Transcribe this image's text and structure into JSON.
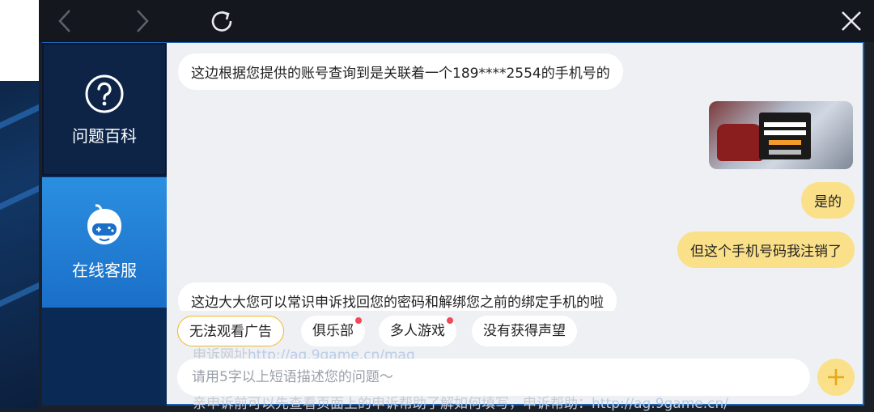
{
  "sidebar": {
    "tabs": [
      {
        "label": "问题百科",
        "icon": "question-icon"
      },
      {
        "label": "在线客服",
        "icon": "gamepad-mascot-icon"
      }
    ]
  },
  "chat": {
    "messages": [
      {
        "side": "left",
        "text": "这边根据您提供的账号查询到是关联着一个189****2554的手机号的"
      },
      {
        "side": "right",
        "type": "image",
        "icon": "screenshot-thumbnail"
      },
      {
        "side": "right",
        "text": "是的"
      },
      {
        "side": "right",
        "text": "但这个手机号码我注销了"
      },
      {
        "side": "left",
        "text": "这边大大您可以常识申诉找回您的密码和解绑您之前的绑定手机的啦"
      }
    ],
    "faded": {
      "prefix": "申诉网址",
      "url": "http://ag.9game.cn/mag",
      "tail": "亲申诉前可以先查看页面上的申诉帮助了解如何填写，申诉帮助：",
      "tail_url": "http://ag.9game.cn/"
    }
  },
  "quick_replies": [
    {
      "label": "无法观看广告",
      "active": true,
      "dot": false
    },
    {
      "label": "俱乐部",
      "active": false,
      "dot": true
    },
    {
      "label": "多人游戏",
      "active": false,
      "dot": true
    },
    {
      "label": "没有获得声望",
      "active": false,
      "dot": false
    }
  ],
  "input": {
    "placeholder": "请用5字以上短语描述您的问题～",
    "value": ""
  },
  "colors": {
    "accent": "#fbe08a",
    "sidebar_active": "#1a6fc8",
    "frame": "#1e63b3",
    "dot": "#f04a57"
  }
}
